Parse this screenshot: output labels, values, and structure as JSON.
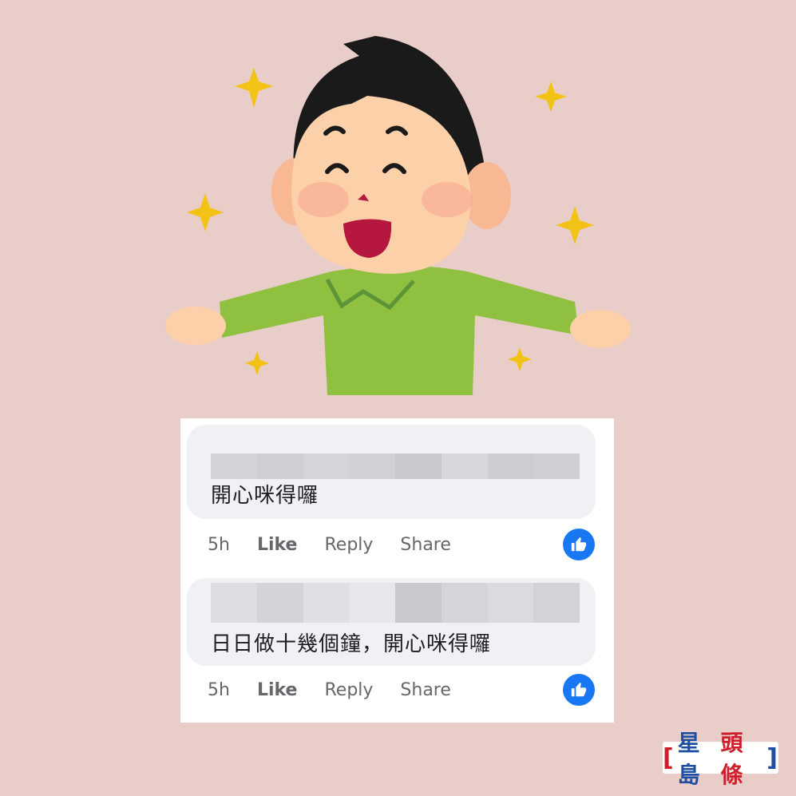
{
  "comments": [
    {
      "author": "[blurred]",
      "text": "開心咪得囉",
      "timestamp": "5h",
      "actions": {
        "like": "Like",
        "reply": "Reply",
        "share": "Share"
      },
      "reaction": "like"
    },
    {
      "author": "[blurred]",
      "text": "日日做十幾個鐘，開心咪得囉",
      "timestamp": "5h",
      "actions": {
        "like": "Like",
        "reply": "Reply",
        "share": "Share"
      },
      "reaction": "like"
    }
  ],
  "illustration": {
    "subject": "happy boy with open arms and sparkles"
  },
  "logo": {
    "part1": "星島",
    "part2": "頭條"
  },
  "colors": {
    "background": "#e8cdc8",
    "like_blue": "#1877f2",
    "logo_blue": "#1f4fa3",
    "logo_red": "#cc1f2a"
  }
}
